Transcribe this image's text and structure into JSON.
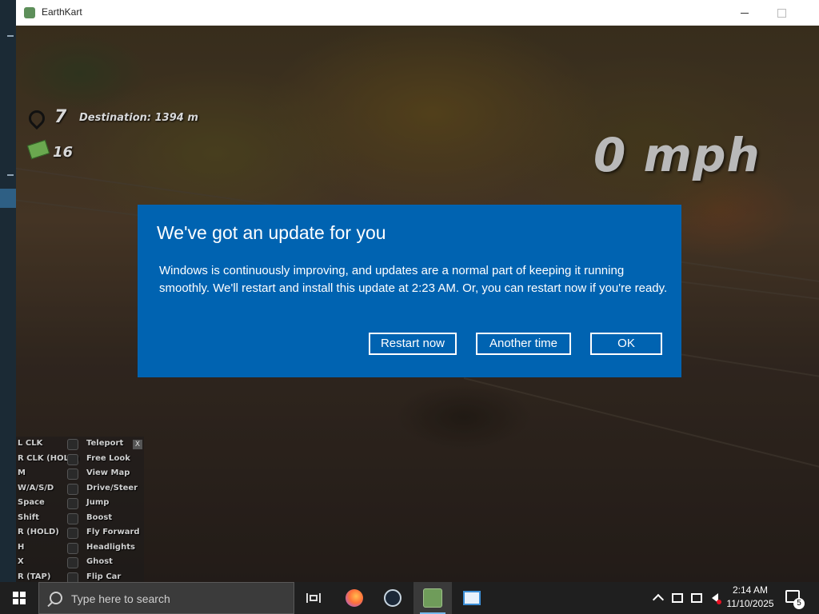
{
  "window": {
    "title": "EarthKart",
    "app_icon": "earthkart-icon"
  },
  "hud": {
    "level": "7",
    "destination": "Destination: 1394 m",
    "cash": "16",
    "speed": "0 mph"
  },
  "controls": {
    "close_label": "X",
    "rows": [
      {
        "key": "L CLK",
        "icon": "mouse-left-icon",
        "action": "Teleport"
      },
      {
        "key": "R CLK (HOLD)",
        "icon": "mouse-right-icon",
        "action": "Free Look"
      },
      {
        "key": "M",
        "icon": "map-icon",
        "action": "View Map"
      },
      {
        "key": "W/A/S/D",
        "icon": "steering-icon",
        "action": "Drive/Steer"
      },
      {
        "key": "Space",
        "icon": "jump-icon",
        "action": "Jump"
      },
      {
        "key": "Shift",
        "icon": "boost-icon",
        "action": "Boost"
      },
      {
        "key": "R (HOLD)",
        "icon": "fly-icon",
        "action": "Fly Forward"
      },
      {
        "key": "H",
        "icon": "headlights-icon",
        "action": "Headlights"
      },
      {
        "key": "X",
        "icon": "ghost-icon",
        "action": "Ghost"
      },
      {
        "key": "R (TAP)",
        "icon": "flip-icon",
        "action": "Flip Car"
      }
    ]
  },
  "dialog": {
    "title": "We've got an update for you",
    "body": "Windows is continuously improving, and updates are a normal part of keeping it running smoothly. We'll restart and install this update at 2:23 AM. Or, you can restart now if you're ready.",
    "restart_label": "Restart now",
    "another_label": "Another time",
    "ok_label": "OK",
    "color": "#0063b1"
  },
  "taskbar": {
    "search_placeholder": "Type here to search",
    "apps": [
      "task-view-icon",
      "firefox-icon",
      "steam-icon",
      "earthkart-icon",
      "notes-icon"
    ],
    "time": "2:14 AM",
    "date": "11/10/2025",
    "notification_count": "5"
  }
}
